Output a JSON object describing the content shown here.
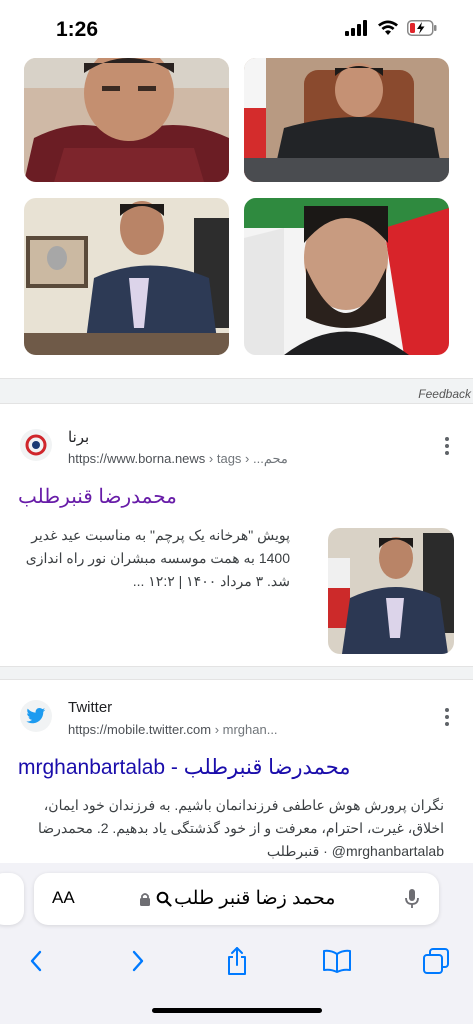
{
  "status_bar": {
    "time": "1:26",
    "battery": "charging"
  },
  "images": {
    "feedback_label": "Feedback"
  },
  "result1": {
    "site_name": "برنا",
    "url": "https://www.borna.news",
    "breadcrumb": "› tags › ...محم",
    "title": "محمدرضا قنبرطلب",
    "snippet_line1": "پویش \"هرخانه یک پرچم\" به مناسبت عید غدیر",
    "snippet_line2": "1400 به همت موسسه مبشران نور راه اندازی",
    "snippet_line3": "شد. ۳ مرداد ۱۴۰۰ | ۱۲:۲ ..."
  },
  "result2": {
    "site_name": "Twitter",
    "url": "https://mobile.twitter.com",
    "breadcrumb": "› mrghan...",
    "title": "mrghanbartalab - محمدرضا قنبرطلب",
    "snippet_line1": "نگران پرورش هوش عاطفی فرزندانمان باشیم. به فرزندان خود ایمان،",
    "snippet_line2": "اخلاق، غیرت، احترام، معرفت و از خود گذشتگی یاد بدهیم. 2. محمدرضا",
    "snippet_line3": "mrghanbartalab@ · قنبرطلب"
  },
  "address_bar": {
    "aa_label": "AA",
    "query": "محمد زضا قنبر طلب"
  },
  "colors": {
    "link_visited": "#681da8",
    "link": "#1a0dab",
    "accent": "#007aff"
  }
}
